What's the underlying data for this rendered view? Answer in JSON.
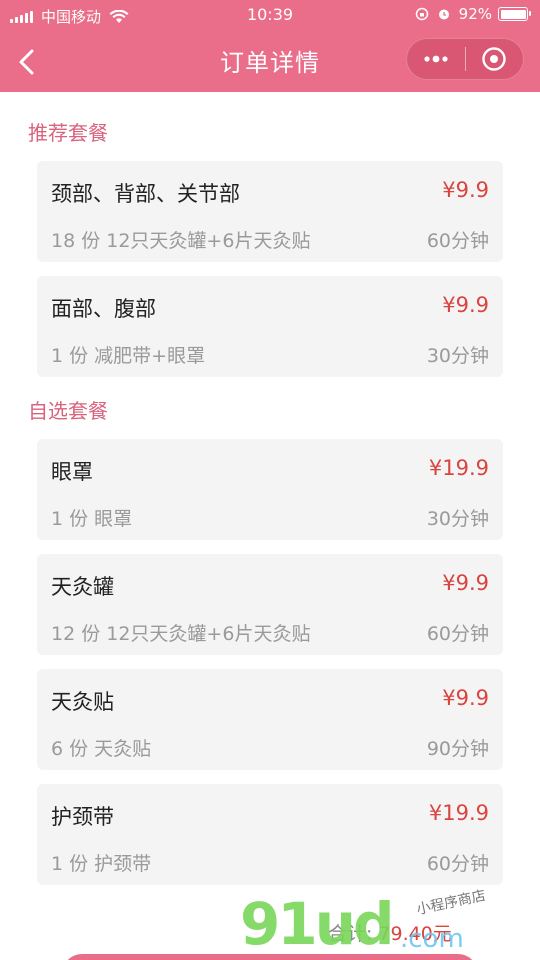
{
  "status_bar": {
    "carrier": "中国移动",
    "time": "10:39",
    "battery": "92%",
    "battery_level": 0.92
  },
  "nav": {
    "title": "订单详情"
  },
  "sections": {
    "recommended": {
      "title": "推荐套餐",
      "items": [
        {
          "name": "颈部、背部、关节部",
          "price": "¥9.9",
          "desc": "18 份 12只天灸罐+6片天灸贴",
          "duration": "60分钟"
        },
        {
          "name": "面部、腹部",
          "price": "¥9.9",
          "desc": "1 份 减肥带+眼罩",
          "duration": "30分钟"
        }
      ]
    },
    "custom": {
      "title": "自选套餐",
      "items": [
        {
          "name": "眼罩",
          "price": "¥19.9",
          "desc": "1 份 眼罩",
          "duration": "30分钟"
        },
        {
          "name": "天灸罐",
          "price": "¥9.9",
          "desc": "12 份 12只天灸罐+6片天灸贴",
          "duration": "60分钟"
        },
        {
          "name": "天灸贴",
          "price": "¥9.9",
          "desc": "6 份 天灸贴",
          "duration": "90分钟"
        },
        {
          "name": "护颈带",
          "price": "¥19.9",
          "desc": "1 份 护颈带",
          "duration": "60分钟"
        }
      ]
    }
  },
  "summary": {
    "total_label": "合计:",
    "total_value": "79.40元"
  },
  "watermark": {
    "logo": "91ud",
    "suffix": ".com",
    "text": "小程序商店"
  },
  "colors": {
    "brand": "#ea6e89",
    "section_title": "#d9627d",
    "price": "#d9443f",
    "card_bg": "#f4f4f4"
  }
}
